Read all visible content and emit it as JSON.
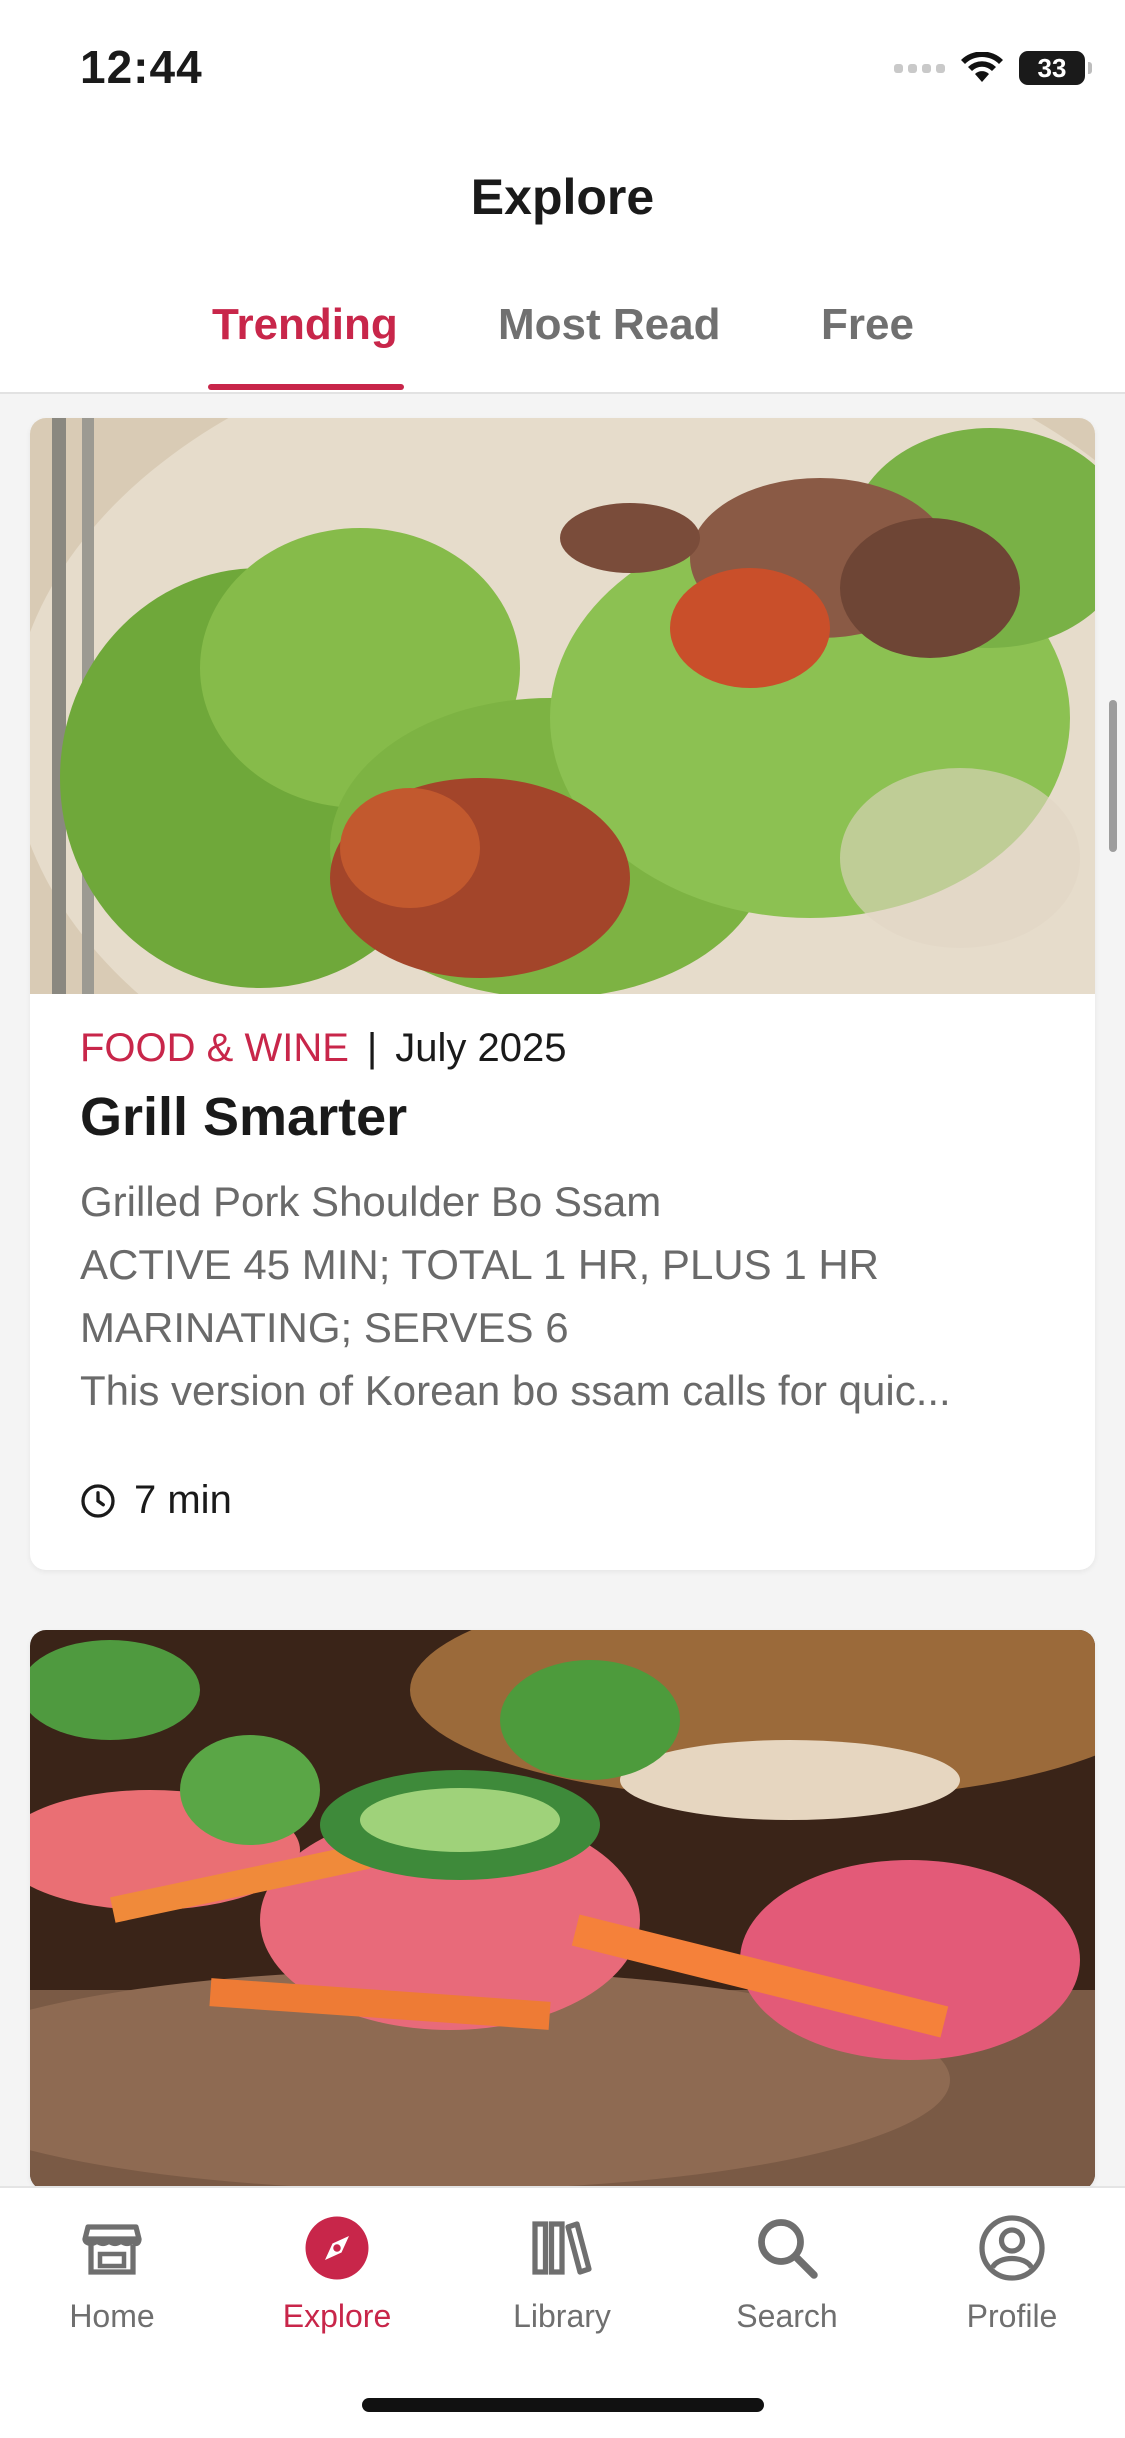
{
  "status_bar": {
    "time": "12:44",
    "battery": "33"
  },
  "header": {
    "title": "Explore"
  },
  "tabs": [
    {
      "label": "Trending",
      "active": true
    },
    {
      "label": "Most Read",
      "active": false
    },
    {
      "label": "Free",
      "active": false
    }
  ],
  "articles": [
    {
      "publication": "FOOD & WINE",
      "separator": "|",
      "date": "July 2025",
      "headline": "Grill Smarter",
      "teaser_lines": [
        "Grilled Pork Shoulder Bo Ssam",
        "ACTIVE 45 MIN; TOTAL 1 HR, PLUS 1 HR",
        "MARINATING; SERVES 6",
        "This version of Korean bo ssam calls for quic..."
      ],
      "read_time": "7 min",
      "image_icon": "lettuce-wrap-photo"
    },
    {
      "image_icon": "banh-mi-sandwich-photo"
    }
  ],
  "bottom_nav": [
    {
      "label": "Home",
      "icon": "home-icon",
      "active": false
    },
    {
      "label": "Explore",
      "icon": "compass-icon",
      "active": true
    },
    {
      "label": "Library",
      "icon": "library-icon",
      "active": false
    },
    {
      "label": "Search",
      "icon": "search-icon",
      "active": false
    },
    {
      "label": "Profile",
      "icon": "profile-icon",
      "active": false
    }
  ],
  "colors": {
    "accent": "#c8264a",
    "inactive": "#6f6f6f",
    "background": "#f4f4f4"
  }
}
